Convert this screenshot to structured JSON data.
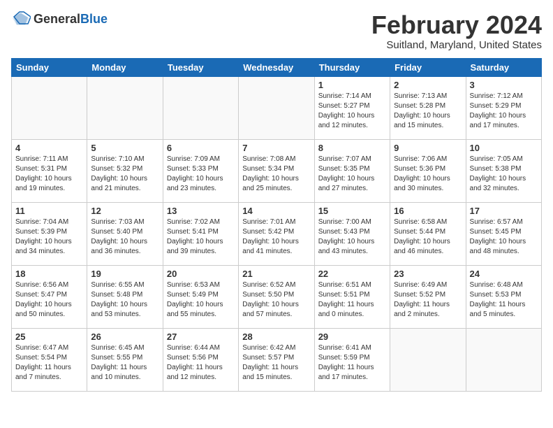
{
  "logo": {
    "general": "General",
    "blue": "Blue"
  },
  "title": "February 2024",
  "subtitle": "Suitland, Maryland, United States",
  "days_of_week": [
    "Sunday",
    "Monday",
    "Tuesday",
    "Wednesday",
    "Thursday",
    "Friday",
    "Saturday"
  ],
  "weeks": [
    [
      {
        "day": "",
        "info": ""
      },
      {
        "day": "",
        "info": ""
      },
      {
        "day": "",
        "info": ""
      },
      {
        "day": "",
        "info": ""
      },
      {
        "day": "1",
        "info": "Sunrise: 7:14 AM\nSunset: 5:27 PM\nDaylight: 10 hours\nand 12 minutes."
      },
      {
        "day": "2",
        "info": "Sunrise: 7:13 AM\nSunset: 5:28 PM\nDaylight: 10 hours\nand 15 minutes."
      },
      {
        "day": "3",
        "info": "Sunrise: 7:12 AM\nSunset: 5:29 PM\nDaylight: 10 hours\nand 17 minutes."
      }
    ],
    [
      {
        "day": "4",
        "info": "Sunrise: 7:11 AM\nSunset: 5:31 PM\nDaylight: 10 hours\nand 19 minutes."
      },
      {
        "day": "5",
        "info": "Sunrise: 7:10 AM\nSunset: 5:32 PM\nDaylight: 10 hours\nand 21 minutes."
      },
      {
        "day": "6",
        "info": "Sunrise: 7:09 AM\nSunset: 5:33 PM\nDaylight: 10 hours\nand 23 minutes."
      },
      {
        "day": "7",
        "info": "Sunrise: 7:08 AM\nSunset: 5:34 PM\nDaylight: 10 hours\nand 25 minutes."
      },
      {
        "day": "8",
        "info": "Sunrise: 7:07 AM\nSunset: 5:35 PM\nDaylight: 10 hours\nand 27 minutes."
      },
      {
        "day": "9",
        "info": "Sunrise: 7:06 AM\nSunset: 5:36 PM\nDaylight: 10 hours\nand 30 minutes."
      },
      {
        "day": "10",
        "info": "Sunrise: 7:05 AM\nSunset: 5:38 PM\nDaylight: 10 hours\nand 32 minutes."
      }
    ],
    [
      {
        "day": "11",
        "info": "Sunrise: 7:04 AM\nSunset: 5:39 PM\nDaylight: 10 hours\nand 34 minutes."
      },
      {
        "day": "12",
        "info": "Sunrise: 7:03 AM\nSunset: 5:40 PM\nDaylight: 10 hours\nand 36 minutes."
      },
      {
        "day": "13",
        "info": "Sunrise: 7:02 AM\nSunset: 5:41 PM\nDaylight: 10 hours\nand 39 minutes."
      },
      {
        "day": "14",
        "info": "Sunrise: 7:01 AM\nSunset: 5:42 PM\nDaylight: 10 hours\nand 41 minutes."
      },
      {
        "day": "15",
        "info": "Sunrise: 7:00 AM\nSunset: 5:43 PM\nDaylight: 10 hours\nand 43 minutes."
      },
      {
        "day": "16",
        "info": "Sunrise: 6:58 AM\nSunset: 5:44 PM\nDaylight: 10 hours\nand 46 minutes."
      },
      {
        "day": "17",
        "info": "Sunrise: 6:57 AM\nSunset: 5:45 PM\nDaylight: 10 hours\nand 48 minutes."
      }
    ],
    [
      {
        "day": "18",
        "info": "Sunrise: 6:56 AM\nSunset: 5:47 PM\nDaylight: 10 hours\nand 50 minutes."
      },
      {
        "day": "19",
        "info": "Sunrise: 6:55 AM\nSunset: 5:48 PM\nDaylight: 10 hours\nand 53 minutes."
      },
      {
        "day": "20",
        "info": "Sunrise: 6:53 AM\nSunset: 5:49 PM\nDaylight: 10 hours\nand 55 minutes."
      },
      {
        "day": "21",
        "info": "Sunrise: 6:52 AM\nSunset: 5:50 PM\nDaylight: 10 hours\nand 57 minutes."
      },
      {
        "day": "22",
        "info": "Sunrise: 6:51 AM\nSunset: 5:51 PM\nDaylight: 11 hours\nand 0 minutes."
      },
      {
        "day": "23",
        "info": "Sunrise: 6:49 AM\nSunset: 5:52 PM\nDaylight: 11 hours\nand 2 minutes."
      },
      {
        "day": "24",
        "info": "Sunrise: 6:48 AM\nSunset: 5:53 PM\nDaylight: 11 hours\nand 5 minutes."
      }
    ],
    [
      {
        "day": "25",
        "info": "Sunrise: 6:47 AM\nSunset: 5:54 PM\nDaylight: 11 hours\nand 7 minutes."
      },
      {
        "day": "26",
        "info": "Sunrise: 6:45 AM\nSunset: 5:55 PM\nDaylight: 11 hours\nand 10 minutes."
      },
      {
        "day": "27",
        "info": "Sunrise: 6:44 AM\nSunset: 5:56 PM\nDaylight: 11 hours\nand 12 minutes."
      },
      {
        "day": "28",
        "info": "Sunrise: 6:42 AM\nSunset: 5:57 PM\nDaylight: 11 hours\nand 15 minutes."
      },
      {
        "day": "29",
        "info": "Sunrise: 6:41 AM\nSunset: 5:59 PM\nDaylight: 11 hours\nand 17 minutes."
      },
      {
        "day": "",
        "info": ""
      },
      {
        "day": "",
        "info": ""
      }
    ]
  ]
}
